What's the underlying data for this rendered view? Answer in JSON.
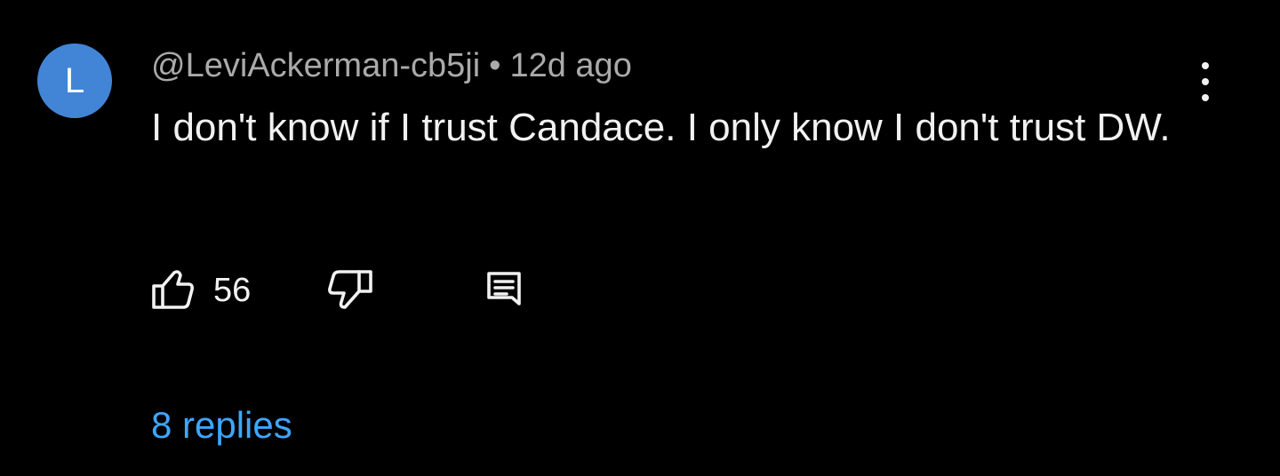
{
  "comment": {
    "avatar_letter": "L",
    "avatar_color": "#4285d6",
    "author": "@LeviAckerman-cb5ji",
    "separator": "•",
    "time": "12d ago",
    "text": "I don't know if I trust Candace. I only know I don't trust DW.",
    "like_count": "56",
    "replies_label": "8 replies",
    "replies_color": "#3ea6ff",
    "icons": {
      "like": "thumbs-up-icon",
      "dislike": "thumbs-down-icon",
      "reply": "comment-icon",
      "menu": "more-vertical-icon"
    }
  }
}
